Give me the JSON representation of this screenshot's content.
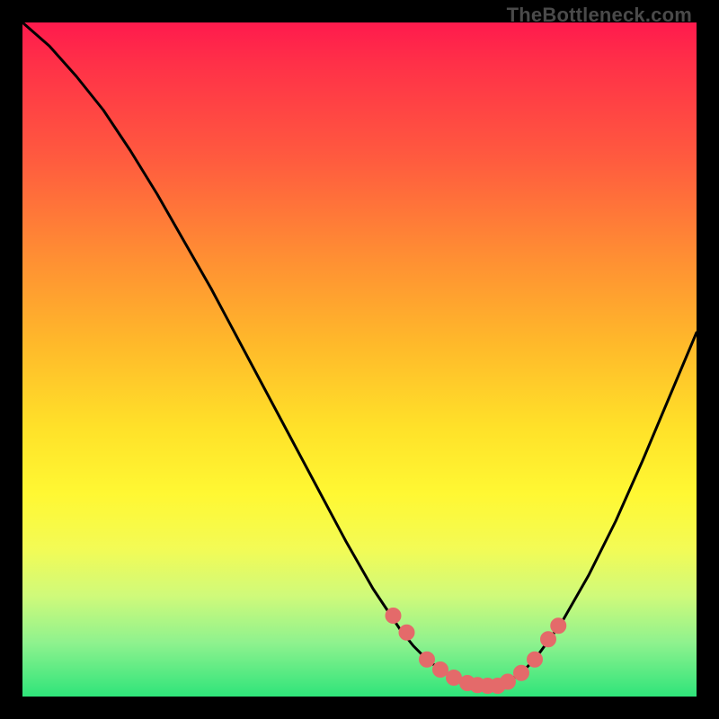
{
  "watermark": "TheBottleneck.com",
  "colors": {
    "curve_stroke": "#000000",
    "marker_fill": "#e46a6a",
    "marker_stroke": "#e46a6a",
    "background_black": "#000000"
  },
  "chart_data": {
    "type": "line",
    "title": "",
    "xlabel": "",
    "ylabel": "",
    "xlim": [
      0,
      100
    ],
    "ylim": [
      0,
      100
    ],
    "series": [
      {
        "name": "bottleneck-curve",
        "x": [
          0,
          4,
          8,
          12,
          16,
          20,
          24,
          28,
          32,
          36,
          40,
          44,
          48,
          52,
          56,
          58,
          60,
          62,
          64,
          66,
          68,
          70,
          72,
          74,
          76,
          80,
          84,
          88,
          92,
          96,
          100
        ],
        "y": [
          100,
          96.5,
          92,
          87,
          81,
          74.5,
          67.5,
          60.5,
          53,
          45.5,
          38,
          30.5,
          23,
          16,
          10,
          7.5,
          5.5,
          4,
          2.8,
          2,
          1.6,
          1.6,
          2.2,
          3.5,
          5.5,
          11,
          18,
          26,
          35,
          44.5,
          54
        ]
      }
    ],
    "markers": {
      "name": "highlight-points",
      "x": [
        55,
        57,
        60,
        62,
        64,
        66,
        67.5,
        69,
        70.5,
        72,
        74,
        76,
        78,
        79.5
      ],
      "y": [
        12,
        9.5,
        5.5,
        4,
        2.8,
        2,
        1.7,
        1.6,
        1.6,
        2.2,
        3.5,
        5.5,
        8.5,
        10.5
      ]
    }
  }
}
